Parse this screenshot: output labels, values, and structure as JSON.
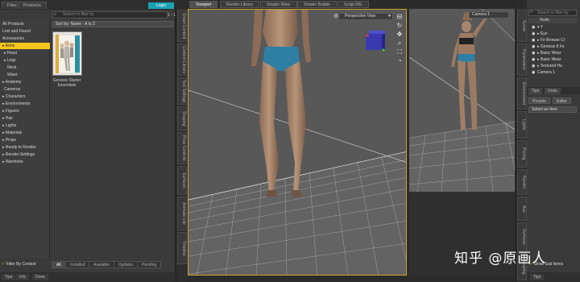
{
  "top_tabs": [
    "Files",
    "Products"
  ],
  "login_label": "Login",
  "library": {
    "search_placeholder": "Search in filter by",
    "sort_label": "Sort by: Name - A to Z",
    "count": "1 - 1",
    "tree": [
      "All Products",
      "Lost and Found",
      "Accessories",
      "▸ Arms",
      "▸ Head",
      "▸ Legs",
      "Neck",
      "Waist",
      "▸ Anatomy",
      "Cameras",
      "▸ Characters",
      "▸ Environments",
      "▸ Figures",
      "▸ Hair",
      "▸ Lights",
      "▸ Materials",
      "▸ Props",
      "▸ Ready to Render",
      "▸ Render-Settings",
      "▸ Wardrobe"
    ],
    "selected_index": 3,
    "product_label": "Genesis Starter Essentials",
    "bottom_tabs": [
      "All",
      "Installed",
      "Available",
      "Updates",
      "Pending"
    ],
    "filter_label": "Filter By Context",
    "footer": [
      "Tips",
      "Info",
      "Done"
    ]
  },
  "left_strip_tabs": [
    "Smart Content",
    "Content Library",
    "Tool Settings",
    "Shaping",
    "Pose Controls",
    "Surfaces",
    "Animate Lite",
    "Timeline"
  ],
  "viewport": {
    "tabs": [
      "Viewport",
      "Render Library",
      "Shader Mixer",
      "Shader Builder",
      "Script IDE"
    ],
    "active_tab": 0,
    "main_camera": "Perspective View",
    "aux_camera": "Camera 1",
    "nav_icons": [
      "arrange-icon",
      "rotate-icon",
      "pan-icon",
      "zoom-icon",
      "frame-icon",
      "orbit-icon"
    ]
  },
  "right_strip_tabs": [
    "Scene",
    "Parameters",
    "Environment",
    "Lights",
    "Posing",
    "Render",
    "Aux",
    "Surfaces",
    "Shaping",
    "Manip"
  ],
  "scene": {
    "search_placeholder": "Search in filter by",
    "header": "Node",
    "nodes": [
      "▾ Y",
      "▸ Eye",
      "▸ Fe Browse Cl",
      "▸ Genesis 8 Fe",
      "▸ Basic Wear",
      "▸ Basic Wear",
      "▸ Textured Ha",
      "Camera 1"
    ],
    "panel_tabs": [
      "Tips",
      "Undo"
    ],
    "preset_tabs": [
      "Presets",
      "Editor"
    ],
    "preset_select": "Select an Item",
    "show_sub_items": "Show Sub Items",
    "footer": [
      "Tips"
    ]
  },
  "watermark": "知乎 @原画人",
  "colors": {
    "accent": "#1aa3b5",
    "selection": "#f5c51b",
    "viewport_border": "#c9a624",
    "viewport_bg": "#575757",
    "floor_grid": "#d0d0d0",
    "bikini": "#2f7fa5"
  }
}
